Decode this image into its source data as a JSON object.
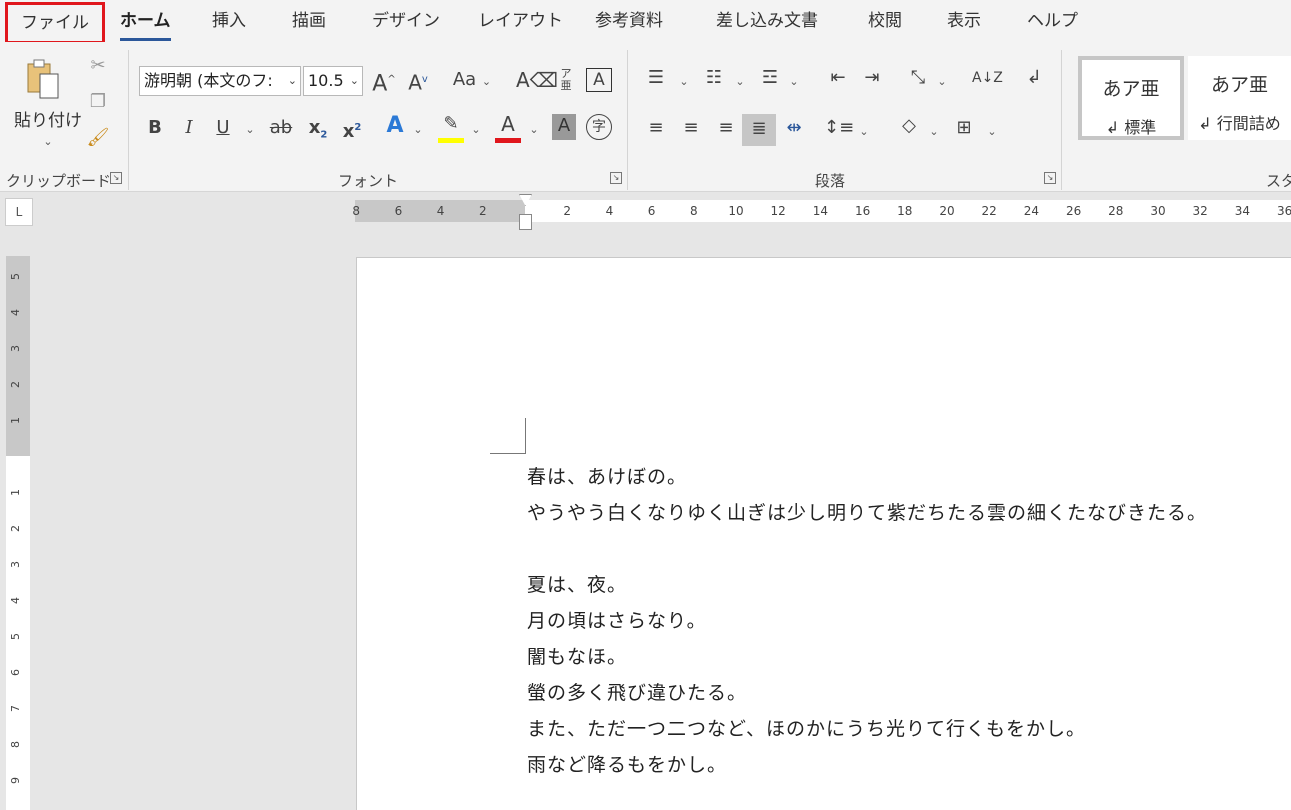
{
  "tabs": [
    {
      "label": "ファイル"
    },
    {
      "label": "ホーム"
    },
    {
      "label": "挿入"
    },
    {
      "label": "描画"
    },
    {
      "label": "デザイン"
    },
    {
      "label": "レイアウト"
    },
    {
      "label": "参考資料"
    },
    {
      "label": "差し込み文書"
    },
    {
      "label": "校閲"
    },
    {
      "label": "表示"
    },
    {
      "label": "ヘルプ"
    }
  ],
  "ribbon": {
    "clipboard": {
      "paste_label": "貼り付け",
      "group_label": "クリップボード"
    },
    "font": {
      "font_name": "游明朝 (本文のフ:",
      "font_size": "10.5",
      "group_label": "フォント",
      "case_label": "Aa",
      "highlight_color": "#ffff00",
      "font_color": "#e0161c"
    },
    "paragraph": {
      "group_label": "段落"
    },
    "styles": {
      "group_label": "スタ",
      "items": [
        {
          "preview": "あア亜",
          "name": "標準"
        },
        {
          "preview": "あア亜",
          "name": "行間詰め"
        }
      ]
    }
  },
  "ruler": {
    "h_numbers": [
      "8",
      "6",
      "4",
      "2",
      "2",
      "4",
      "6",
      "8",
      "10",
      "12",
      "14",
      "16",
      "18",
      "20",
      "22",
      "24",
      "26",
      "28",
      "30",
      "32",
      "34",
      "36"
    ],
    "v_numbers": [
      "5",
      "4",
      "3",
      "2",
      "1",
      "1",
      "2",
      "3",
      "4",
      "5",
      "6",
      "7",
      "8",
      "9"
    ]
  },
  "document": {
    "lines": [
      "春は、あけぼの。",
      "やうやう白くなりゆく山ぎは少し明りて紫だちたる雲の細くたなびきたる。",
      "",
      "夏は、夜。",
      "月の頃はさらなり。",
      "闇もなほ。",
      "螢の多く飛び違ひたる。",
      "また、ただ一つ二つなど、ほのかにうち光りて行くもをかし。",
      "雨など降るもをかし。"
    ]
  },
  "colors": {
    "accent": "#2b579a",
    "file_highlight": "#e0161c"
  }
}
